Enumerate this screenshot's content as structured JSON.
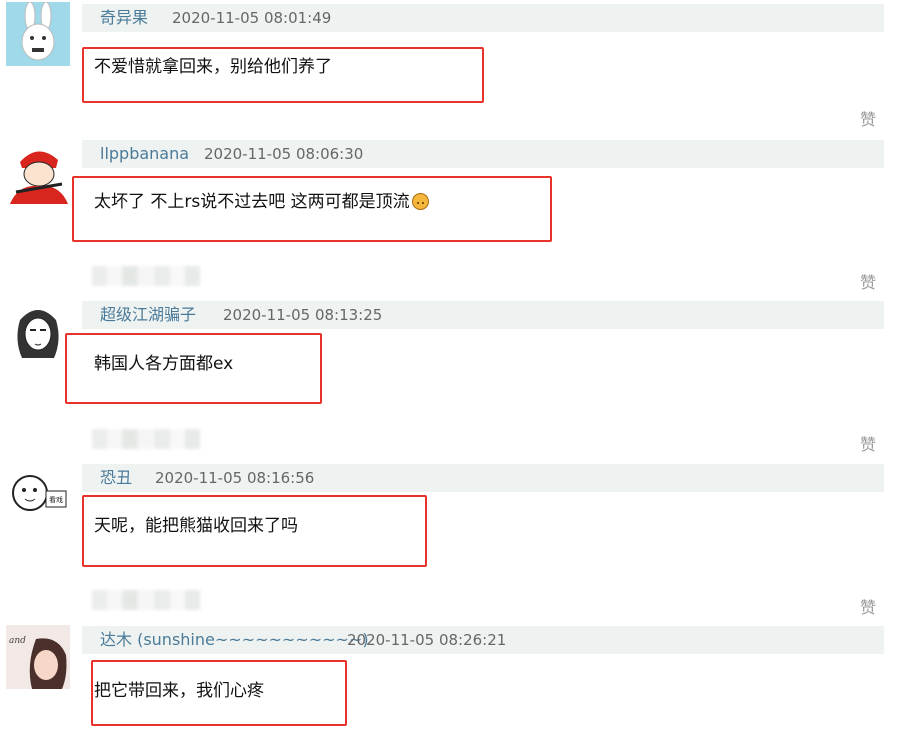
{
  "like_label": "赞",
  "comments": [
    {
      "username": "奇异果",
      "time": "2020-11-05 08:01:49",
      "text": "不爱惜就拿回来，别给他们养了",
      "avatar": "bunny-avatar-icon"
    },
    {
      "username": "llppbanana",
      "time": "2020-11-05 08:06:30",
      "text": "太坏了 不上rs说不过去吧 这两可都是顶流",
      "avatar": "red-cap-boy-avatar-icon"
    },
    {
      "username": "超级江湖骗子",
      "time": "2020-11-05 08:13:25",
      "text": "韩国人各方面都ex",
      "avatar": "sketch-girl-avatar-icon"
    },
    {
      "username": "恐丑",
      "time": "2020-11-05 08:16:56",
      "text": "天呢，能把熊猫收回来了吗",
      "avatar": "doodle-face-avatar-icon",
      "avatar_caption": "看戏"
    },
    {
      "username": "达木 (sunshine~~~~~~~~~~~)",
      "time": "2020-11-05 08:26:21",
      "text": "把它带回来，我们心疼",
      "avatar": "portrait-avatar-icon",
      "avatar_caption": "and"
    }
  ],
  "colors": {
    "highlight": "#e8322c",
    "username": "#4b7a99",
    "meta_bg": "#eef3f1"
  }
}
